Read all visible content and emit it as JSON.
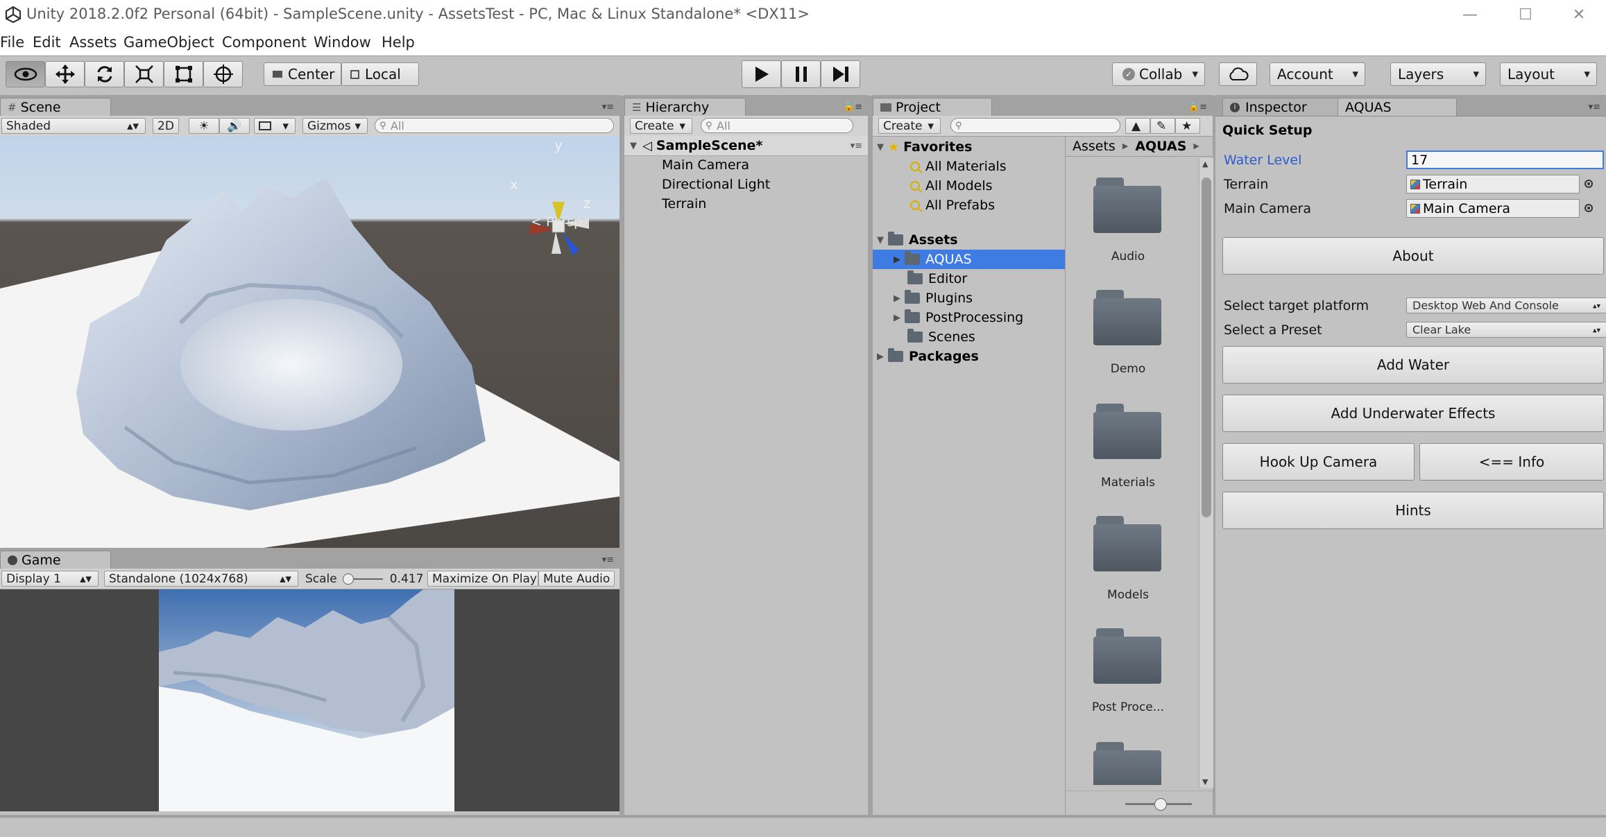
{
  "window": {
    "title": "Unity 2018.2.0f2 Personal (64bit) - SampleScene.unity - AssetsTest - PC, Mac & Linux Standalone* <DX11>",
    "minimize_glyph": "—",
    "maximize_glyph": "☐",
    "close_glyph": "✕"
  },
  "menubar": [
    "File",
    "Edit",
    "Assets",
    "GameObject",
    "Component",
    "Window",
    "Help"
  ],
  "toolbar": {
    "pivot_label": "Center",
    "space_label": "Local",
    "collab_label": "Collab",
    "account_label": "Account",
    "layers_label": "Layers",
    "layout_label": "Layout"
  },
  "scene": {
    "tab_label": "Scene",
    "shading_mode": "Shaded",
    "mode_2d_label": "2D",
    "gizmos_label": "Gizmos",
    "search_placeholder": "All",
    "projection_label": "Persp",
    "axis_x": "x",
    "axis_y": "y",
    "axis_z": "z"
  },
  "game": {
    "tab_label": "Game",
    "display_label": "Display 1",
    "resolution_label": "Standalone (1024x768)",
    "scale_label": "Scale",
    "scale_value": "0.417",
    "maximize_label": "Maximize On Play",
    "mute_label": "Mute Audio"
  },
  "hierarchy": {
    "tab_label": "Hierarchy",
    "create_label": "Create",
    "search_placeholder": "All",
    "scene_name": "SampleScene*",
    "items": [
      "Main Camera",
      "Directional Light",
      "Terrain"
    ]
  },
  "project": {
    "tab_label": "Project",
    "create_label": "Create",
    "favorites_label": "Favorites",
    "favorites": [
      "All Materials",
      "All Models",
      "All Prefabs"
    ],
    "assets_label": "Assets",
    "asset_folders": [
      {
        "name": "AQUAS",
        "expandable": true,
        "selected": true
      },
      {
        "name": "Editor",
        "expandable": false,
        "selected": false
      },
      {
        "name": "Plugins",
        "expandable": true,
        "selected": false
      },
      {
        "name": "PostProcessing",
        "expandable": true,
        "selected": false
      },
      {
        "name": "Scenes",
        "expandable": false,
        "selected": false
      }
    ],
    "packages_label": "Packages",
    "breadcrumb": [
      "Assets",
      "AQUAS"
    ],
    "grid_items": [
      "Audio",
      "Demo",
      "Materials",
      "Models",
      "Post Proce..."
    ]
  },
  "inspector": {
    "tab_label": "Inspector",
    "second_tab_label": "AQUAS",
    "section_title": "Quick Setup",
    "water_level_label": "Water Level",
    "water_level_value": "17",
    "terrain_label": "Terrain",
    "terrain_value": "Terrain",
    "camera_label": "Main Camera",
    "camera_value": "Main Camera",
    "about_button": "About",
    "platform_label": "Select target platform",
    "platform_value": "Desktop Web And Console",
    "preset_label": "Select a Preset",
    "preset_value": "Clear Lake",
    "add_water_button": "Add Water",
    "underwater_button": "Add Underwater Effects",
    "hook_camera_button": "Hook Up Camera",
    "info_button": "<== Info",
    "hints_button": "Hints"
  },
  "colors": {
    "selection": "#3e7ce4",
    "editor_gray": "#c2c2c2",
    "field_blue_label": "#2c5ccc",
    "sky": "#8aa3c6",
    "ground": "#ffffff",
    "terrain": "#b8c4d6"
  }
}
